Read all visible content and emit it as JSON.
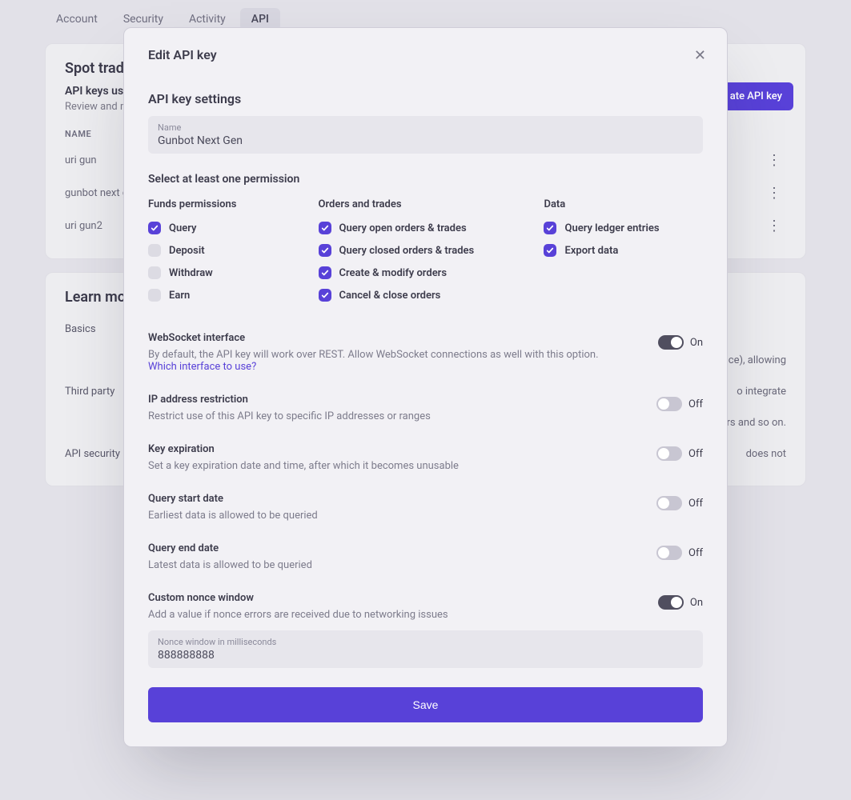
{
  "tabs": {
    "items": [
      {
        "label": "Account",
        "active": false
      },
      {
        "label": "Security",
        "active": false
      },
      {
        "label": "Activity",
        "active": false
      },
      {
        "label": "API",
        "active": true
      }
    ]
  },
  "spot_card": {
    "title": "Spot trading",
    "subtitle": "API keys use",
    "desc": "Review and m",
    "create_button": "ate API key",
    "name_header": "NAME",
    "rows": [
      {
        "name": "uri gun"
      },
      {
        "name": "gunbot next ge"
      },
      {
        "name": "uri gun2"
      }
    ]
  },
  "learn_card": {
    "title": "Learn more",
    "rows": [
      {
        "label": "Basics",
        "text": ""
      },
      {
        "label": "",
        "text_tail": "ce), allowing"
      },
      {
        "label": "Third party",
        "text": "",
        "text_tail": "o integrate"
      },
      {
        "label": "",
        "text_tail": "rs and so on."
      },
      {
        "label": "API security",
        "text": "",
        "text_tail": " does not"
      }
    ]
  },
  "modal": {
    "title": "Edit API key",
    "section_settings": "API key settings",
    "name_label": "Name",
    "name_value": "Gunbot Next Gen",
    "perm_title": "Select at least one permission",
    "perm_cols": [
      {
        "title": "Funds permissions",
        "items": [
          {
            "label": "Query",
            "checked": true
          },
          {
            "label": "Deposit",
            "checked": false
          },
          {
            "label": "Withdraw",
            "checked": false
          },
          {
            "label": "Earn",
            "checked": false
          }
        ]
      },
      {
        "title": "Orders and trades",
        "items": [
          {
            "label": "Query open orders & trades",
            "checked": true
          },
          {
            "label": "Query closed orders & trades",
            "checked": true
          },
          {
            "label": "Create & modify orders",
            "checked": true
          },
          {
            "label": "Cancel & close orders",
            "checked": true
          }
        ]
      },
      {
        "title": "Data",
        "items": [
          {
            "label": "Query ledger entries",
            "checked": true
          },
          {
            "label": "Export data",
            "checked": true
          }
        ]
      }
    ],
    "options": [
      {
        "key": "websocket",
        "title": "WebSocket interface",
        "desc": "By default, the API key will work over REST. Allow WebSocket connections as well with this option.",
        "link": "Which interface to use?",
        "on": true,
        "label_on": "On"
      },
      {
        "key": "ip",
        "title": "IP address restriction",
        "desc": "Restrict use of this API key to specific IP addresses or ranges",
        "on": false,
        "label_off": "Off"
      },
      {
        "key": "expiration",
        "title": "Key expiration",
        "desc": "Set a key expiration date and time, after which it becomes unusable",
        "on": false,
        "label_off": "Off"
      },
      {
        "key": "qstart",
        "title": "Query start date",
        "desc": "Earliest data is allowed to be queried",
        "on": false,
        "label_off": "Off"
      },
      {
        "key": "qend",
        "title": "Query end date",
        "desc": "Latest data is allowed to be queried",
        "on": false,
        "label_off": "Off"
      },
      {
        "key": "nonce",
        "title": "Custom nonce window",
        "desc": "Add a value if nonce errors are received due to networking issues",
        "on": true,
        "label_on": "On",
        "field_label": "Nonce window in milliseconds",
        "field_value": "888888888"
      }
    ],
    "save": "Save"
  }
}
